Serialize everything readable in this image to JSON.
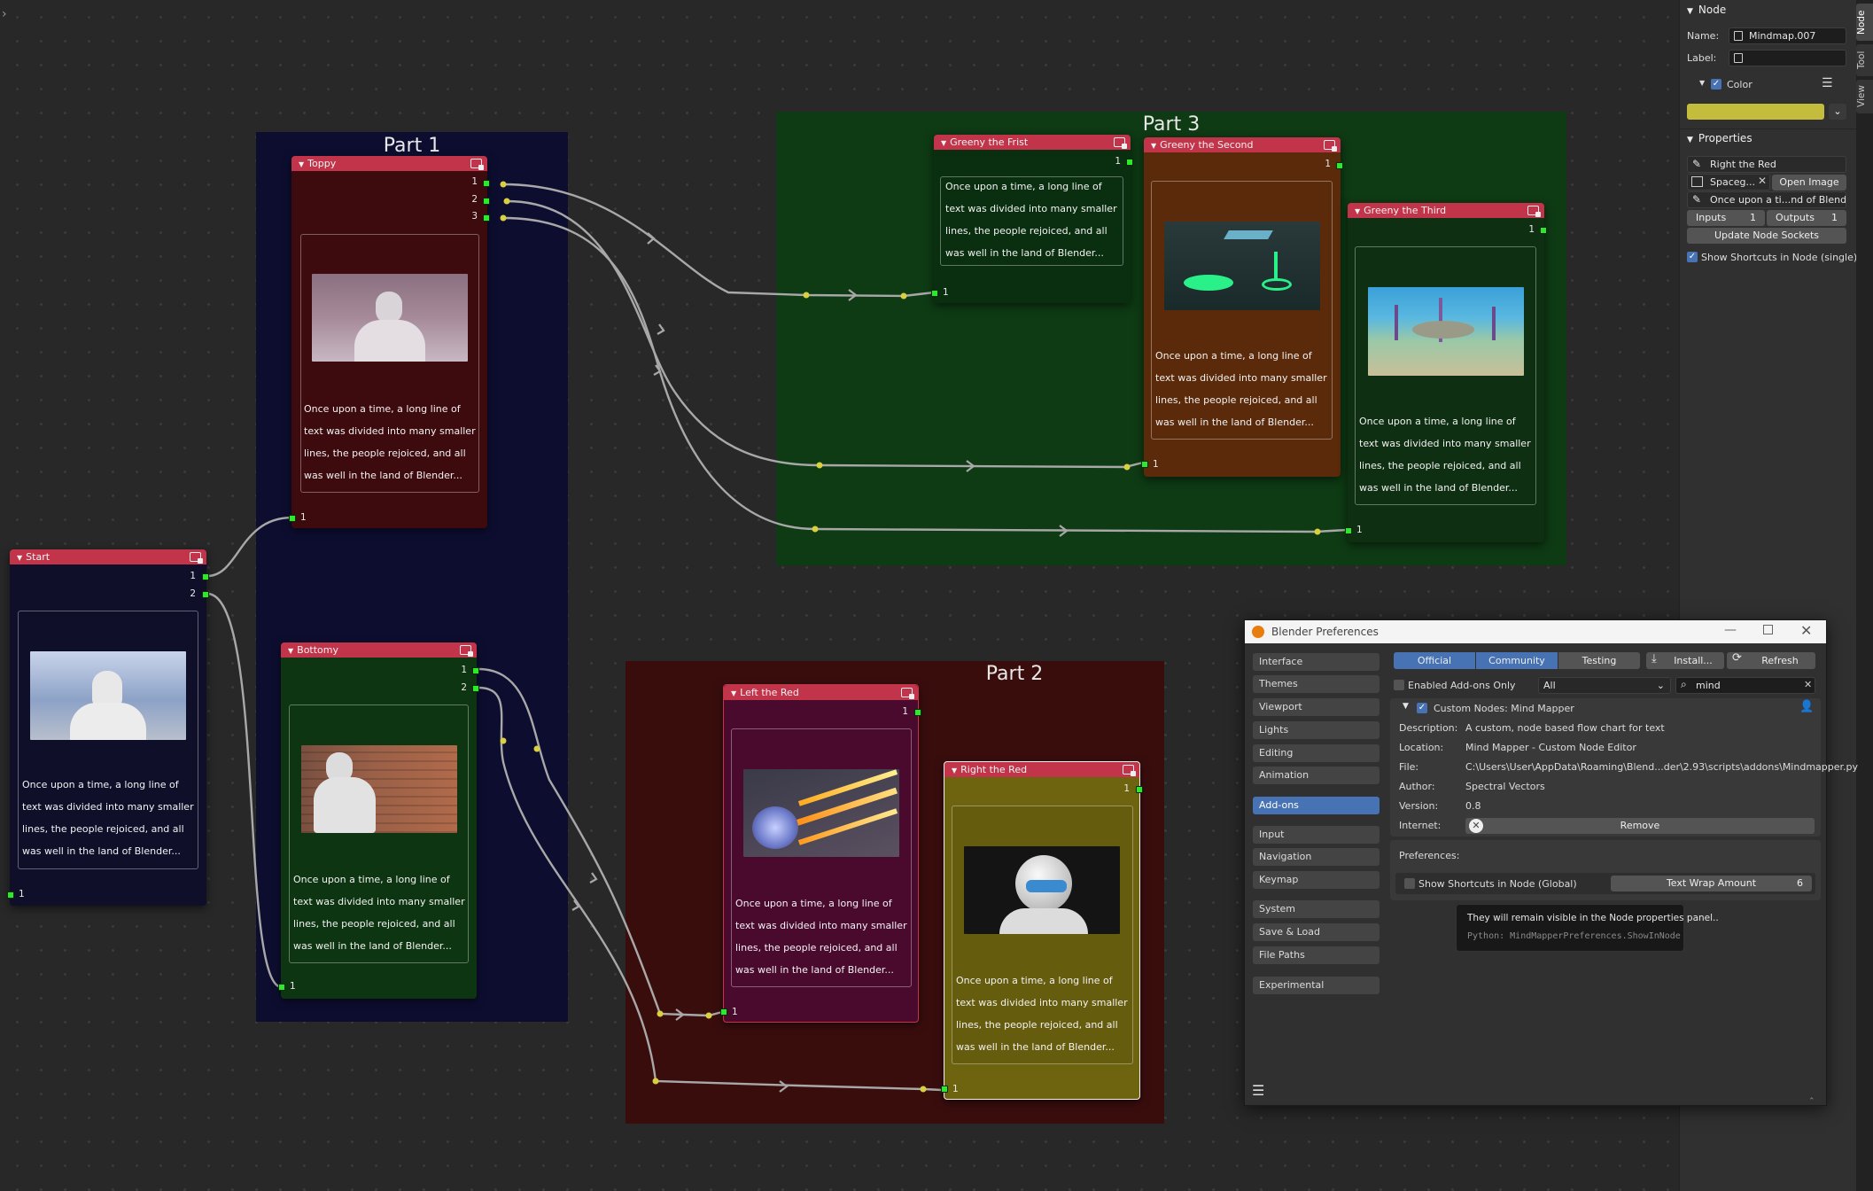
{
  "canvas": {
    "corner_glyph": "›"
  },
  "frames": {
    "part1": {
      "label": "Part 1",
      "color": "#0d0d30"
    },
    "part2": {
      "label": "Part 2",
      "color": "#3a0d0d"
    },
    "part3": {
      "label": "Part 3",
      "color": "#0e3a14"
    }
  },
  "node_text": "Once upon a time, a long line of text was divided into many smaller lines, the people rejoiced, and all was well in the land of Blender...",
  "nodes": {
    "start": {
      "title": "Start",
      "outputs": [
        "1",
        "2"
      ],
      "inputs": [
        "1"
      ],
      "image_desc": "white-robot-sky"
    },
    "toppy": {
      "title": "Toppy",
      "outputs": [
        "1",
        "2",
        "3"
      ],
      "inputs": [
        "1"
      ],
      "image_desc": "robot-back-pink"
    },
    "bottomy": {
      "title": "Bottomy",
      "outputs": [
        "1",
        "2"
      ],
      "inputs": [
        "1"
      ],
      "image_desc": "robot-brick-wall"
    },
    "left_red": {
      "title": "Left the Red",
      "outputs": [
        "1"
      ],
      "inputs": [
        "1"
      ],
      "image_desc": "flying-debris"
    },
    "right_red": {
      "title": "Right the Red",
      "outputs": [
        "1"
      ],
      "inputs": [
        "1"
      ],
      "image_desc": "helmet-figure"
    },
    "greeny1": {
      "title": "Greeny the Frist",
      "outputs": [
        "1"
      ],
      "inputs": [
        "1"
      ]
    },
    "greeny2": {
      "title": "Greeny the Second",
      "outputs": [
        "1"
      ],
      "inputs": [
        "1"
      ],
      "image_desc": "green-portal-scene"
    },
    "greeny3": {
      "title": "Greeny the Third",
      "outputs": [
        "1"
      ],
      "inputs": [
        "1"
      ],
      "image_desc": "underwater-seabed"
    }
  },
  "npanel": {
    "tabs": [
      "Node",
      "Tool",
      "View"
    ],
    "section_node": "Node",
    "name_label": "Name:",
    "name_value": "Mindmap.007",
    "label_label": "Label:",
    "label_value": "",
    "color_label": "Color",
    "color_value": "#c4bc3c",
    "section_props": "Properties",
    "prop_title": "Right the Red",
    "prop_image": "Spaceg...",
    "open_image": "Open Image",
    "prop_text": "Once upon a ti...nd of Blender...",
    "inputs_label": "Inputs",
    "inputs_value": "1",
    "outputs_label": "Outputs",
    "outputs_value": "1",
    "update_btn": "Update Node Sockets",
    "show_shortcuts": "Show Shortcuts in Node (single)"
  },
  "prefs": {
    "title": "Blender Preferences",
    "sidebar": [
      "Interface",
      "Themes",
      "Viewport",
      "Lights",
      "Editing",
      "Animation",
      "Add-ons",
      "Input",
      "Navigation",
      "Keymap",
      "System",
      "Save & Load",
      "File Paths",
      "Experimental"
    ],
    "selected": "Add-ons",
    "filter_tabs": [
      "Official",
      "Community",
      "Testing"
    ],
    "install": "Install...",
    "refresh": "Refresh",
    "enabled_only": "Enabled Add-ons Only",
    "category": "All",
    "search": "mind",
    "addon_name": "Custom Nodes: Mind Mapper",
    "description_label": "Description:",
    "description": "A custom, node based flow chart for text",
    "location_label": "Location:",
    "location": "Mind Mapper - Custom Node Editor",
    "file_label": "File:",
    "file": "C:\\Users\\User\\AppData\\Roaming\\Blend...der\\2.93\\scripts\\addons\\Mindmapper.py",
    "author_label": "Author:",
    "author": "Spectral Vectors",
    "version_label": "Version:",
    "version": "0.8",
    "internet_label": "Internet:",
    "remove": "Remove",
    "preferences_label": "Preferences:",
    "show_shortcuts_global": "Show Shortcuts in Node (Global)",
    "text_wrap_label": "Text Wrap Amount",
    "text_wrap_value": "6",
    "tooltip": "They will remain visible in the Node properties panel..",
    "tooltip_python": "Python: MindMapperPreferences.ShowInNode"
  }
}
